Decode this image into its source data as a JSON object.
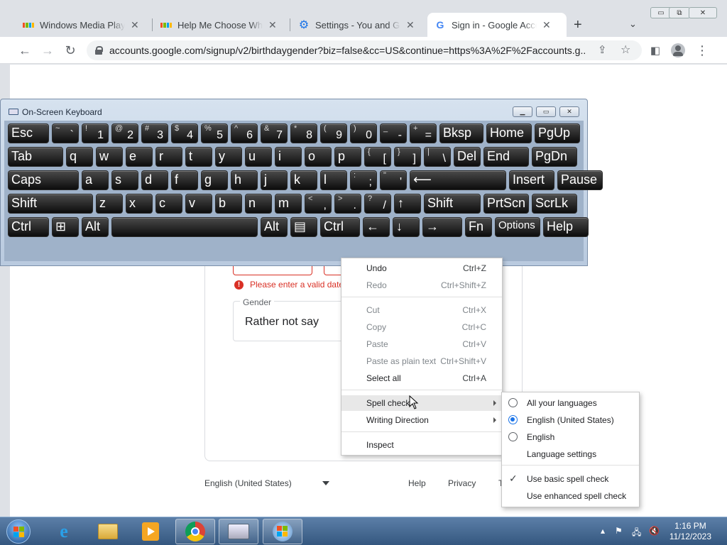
{
  "browser": {
    "tabs": [
      {
        "title": "Windows Media Player c",
        "icon": "microsoft-icon",
        "active": false
      },
      {
        "title": "Help Me Choose Which",
        "icon": "microsoft-icon",
        "active": false
      },
      {
        "title": "Settings - You and Goog",
        "icon": "gear-icon",
        "active": false
      },
      {
        "title": "Sign in - Google Accoun",
        "icon": "google-icon",
        "active": true
      }
    ],
    "new_tab": "+",
    "url": "accounts.google.com/signup/v2/birthdaygender?biz=false&cc=US&continue=https%3A%2F%2Faccounts.g...",
    "window_controls": {
      "minimize": "▭",
      "restore": "⧉",
      "close": "✕"
    }
  },
  "page": {
    "error_text": "Please enter a valid date",
    "gender_label": "Gender",
    "gender_value": "Rather not say",
    "footer": {
      "language": "English (United States)",
      "help": "Help",
      "privacy": "Privacy",
      "terms": "T"
    }
  },
  "osk": {
    "title": "On-Screen Keyboard",
    "rows": [
      [
        [
          "Esc",
          ""
        ],
        [
          "~",
          "`"
        ],
        [
          "!",
          "1"
        ],
        [
          "@",
          "2"
        ],
        [
          "#",
          "3"
        ],
        [
          "$",
          "4"
        ],
        [
          "%",
          "5"
        ],
        [
          "^",
          "6"
        ],
        [
          "&",
          "7"
        ],
        [
          "*",
          "8"
        ],
        [
          "(",
          "9"
        ],
        [
          ")",
          "0"
        ],
        [
          "_",
          "-"
        ],
        [
          "+",
          "="
        ],
        [
          "Bksp",
          ""
        ],
        [
          "Home",
          ""
        ],
        [
          "PgUp",
          ""
        ]
      ],
      [
        [
          "Tab",
          ""
        ],
        [
          "q",
          ""
        ],
        [
          "w",
          ""
        ],
        [
          "e",
          ""
        ],
        [
          "r",
          ""
        ],
        [
          "t",
          ""
        ],
        [
          "y",
          ""
        ],
        [
          "u",
          ""
        ],
        [
          "i",
          ""
        ],
        [
          "o",
          ""
        ],
        [
          "p",
          ""
        ],
        [
          "{",
          "["
        ],
        [
          "}",
          "]"
        ],
        [
          "|",
          "\\"
        ],
        [
          "Del",
          ""
        ],
        [
          "End",
          ""
        ],
        [
          "PgDn",
          ""
        ]
      ],
      [
        [
          "Caps",
          ""
        ],
        [
          "a",
          ""
        ],
        [
          "s",
          ""
        ],
        [
          "d",
          ""
        ],
        [
          "f",
          ""
        ],
        [
          "g",
          ""
        ],
        [
          "h",
          ""
        ],
        [
          "j",
          ""
        ],
        [
          "k",
          ""
        ],
        [
          "l",
          ""
        ],
        [
          ":",
          ";"
        ],
        [
          "\"",
          "'"
        ],
        [
          "⟵",
          ""
        ],
        [
          "Insert",
          ""
        ],
        [
          "Pause",
          ""
        ]
      ],
      [
        [
          "Shift",
          ""
        ],
        [
          "z",
          ""
        ],
        [
          "x",
          ""
        ],
        [
          "c",
          ""
        ],
        [
          "v",
          ""
        ],
        [
          "b",
          ""
        ],
        [
          "n",
          ""
        ],
        [
          "m",
          ""
        ],
        [
          "<",
          ","
        ],
        [
          ">",
          "."
        ],
        [
          "?",
          "/"
        ],
        [
          "↑",
          ""
        ],
        [
          "Shift",
          ""
        ],
        [
          "PrtScn",
          ""
        ],
        [
          "ScrLk",
          ""
        ]
      ],
      [
        [
          "Ctrl",
          ""
        ],
        [
          "⊞",
          ""
        ],
        [
          "Alt",
          ""
        ],
        [
          "",
          ""
        ],
        [
          "Alt",
          ""
        ],
        [
          "▤",
          ""
        ],
        [
          "Ctrl",
          ""
        ],
        [
          "←",
          ""
        ],
        [
          "↓",
          ""
        ],
        [
          "→",
          ""
        ],
        [
          "Fn",
          ""
        ],
        [
          "Options",
          ""
        ],
        [
          "Help",
          ""
        ]
      ]
    ]
  },
  "context_menu": {
    "items": [
      {
        "label": "Undo",
        "shortcut": "Ctrl+Z",
        "disabled": false
      },
      {
        "label": "Redo",
        "shortcut": "Ctrl+Shift+Z",
        "disabled": true
      },
      {
        "label": "Cut",
        "shortcut": "Ctrl+X",
        "disabled": true
      },
      {
        "label": "Copy",
        "shortcut": "Ctrl+C",
        "disabled": true
      },
      {
        "label": "Paste",
        "shortcut": "Ctrl+V",
        "disabled": true
      },
      {
        "label": "Paste as plain text",
        "shortcut": "Ctrl+Shift+V",
        "disabled": true
      },
      {
        "label": "Select all",
        "shortcut": "Ctrl+A",
        "disabled": false
      },
      {
        "label": "Spell check",
        "shortcut": "",
        "disabled": false
      },
      {
        "label": "Writing Direction",
        "shortcut": "",
        "disabled": false
      },
      {
        "label": "Inspect",
        "shortcut": "",
        "disabled": false
      }
    ]
  },
  "spell_submenu": {
    "items": [
      {
        "label": "All your languages",
        "kind": "radio",
        "checked": false
      },
      {
        "label": "English (United States)",
        "kind": "radio",
        "checked": true
      },
      {
        "label": "English",
        "kind": "radio",
        "checked": false
      },
      {
        "label": "Language settings",
        "kind": "plain",
        "checked": false
      },
      {
        "label": "Use basic spell check",
        "kind": "check",
        "checked": true
      },
      {
        "label": "Use enhanced spell check",
        "kind": "check",
        "checked": false
      }
    ]
  },
  "taskbar": {
    "time": "1:16 PM",
    "date": "11/12/2023"
  },
  "colors": {
    "accent": "#1a73e8",
    "error": "#d93025",
    "chrome_bg": "#dee1e6"
  }
}
